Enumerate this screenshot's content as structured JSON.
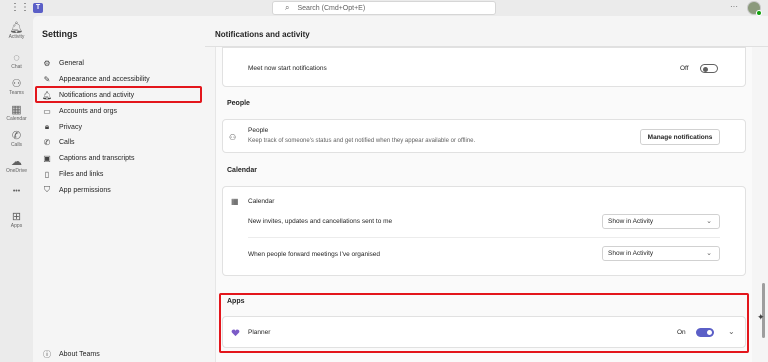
{
  "topbar": {
    "search_placeholder": "Search (Cmd+Opt+E)",
    "more": "···"
  },
  "rail": {
    "items": [
      {
        "label": "Activity",
        "icon": "bell-icon"
      },
      {
        "label": "Chat",
        "icon": "chat-icon"
      },
      {
        "label": "Teams",
        "icon": "teams-icon"
      },
      {
        "label": "Calendar",
        "icon": "calendar-icon"
      },
      {
        "label": "Calls",
        "icon": "phone-icon"
      },
      {
        "label": "OneDrive",
        "icon": "cloud-icon"
      },
      {
        "label": "Apps",
        "icon": "apps-icon"
      }
    ],
    "more": "•••"
  },
  "settings": {
    "title": "Settings",
    "nav": [
      {
        "label": "General",
        "icon": "gear-icon"
      },
      {
        "label": "Appearance and accessibility",
        "icon": "brush-icon"
      },
      {
        "label": "Notifications and activity",
        "icon": "bell-icon",
        "selected": true
      },
      {
        "label": "Accounts and orgs",
        "icon": "id-card-icon"
      },
      {
        "label": "Privacy",
        "icon": "lock-icon"
      },
      {
        "label": "Calls",
        "icon": "phone-icon"
      },
      {
        "label": "Captions and transcripts",
        "icon": "cc-icon"
      },
      {
        "label": "Files and links",
        "icon": "file-icon"
      },
      {
        "label": "App permissions",
        "icon": "shield-icon"
      }
    ],
    "about": "About Teams"
  },
  "main": {
    "title": "Notifications and activity",
    "meet_now": {
      "label": "Meet now start notifications",
      "state": "Off"
    },
    "people": {
      "section": "People",
      "title": "People",
      "description": "Keep track of someone's status and get notified when they appear available or offline.",
      "button": "Manage notifications"
    },
    "calendar": {
      "section": "Calendar",
      "title": "Calendar",
      "rows": [
        {
          "label": "New invites, updates and cancellations sent to me",
          "value": "Show in Activity"
        },
        {
          "label": "When people forward meetings I've organised",
          "value": "Show in Activity"
        }
      ]
    },
    "apps": {
      "section": "Apps",
      "app_name": "Planner",
      "state": "On"
    }
  },
  "colors": {
    "accent": "#5b5fc7",
    "highlight": "#e3161c"
  }
}
